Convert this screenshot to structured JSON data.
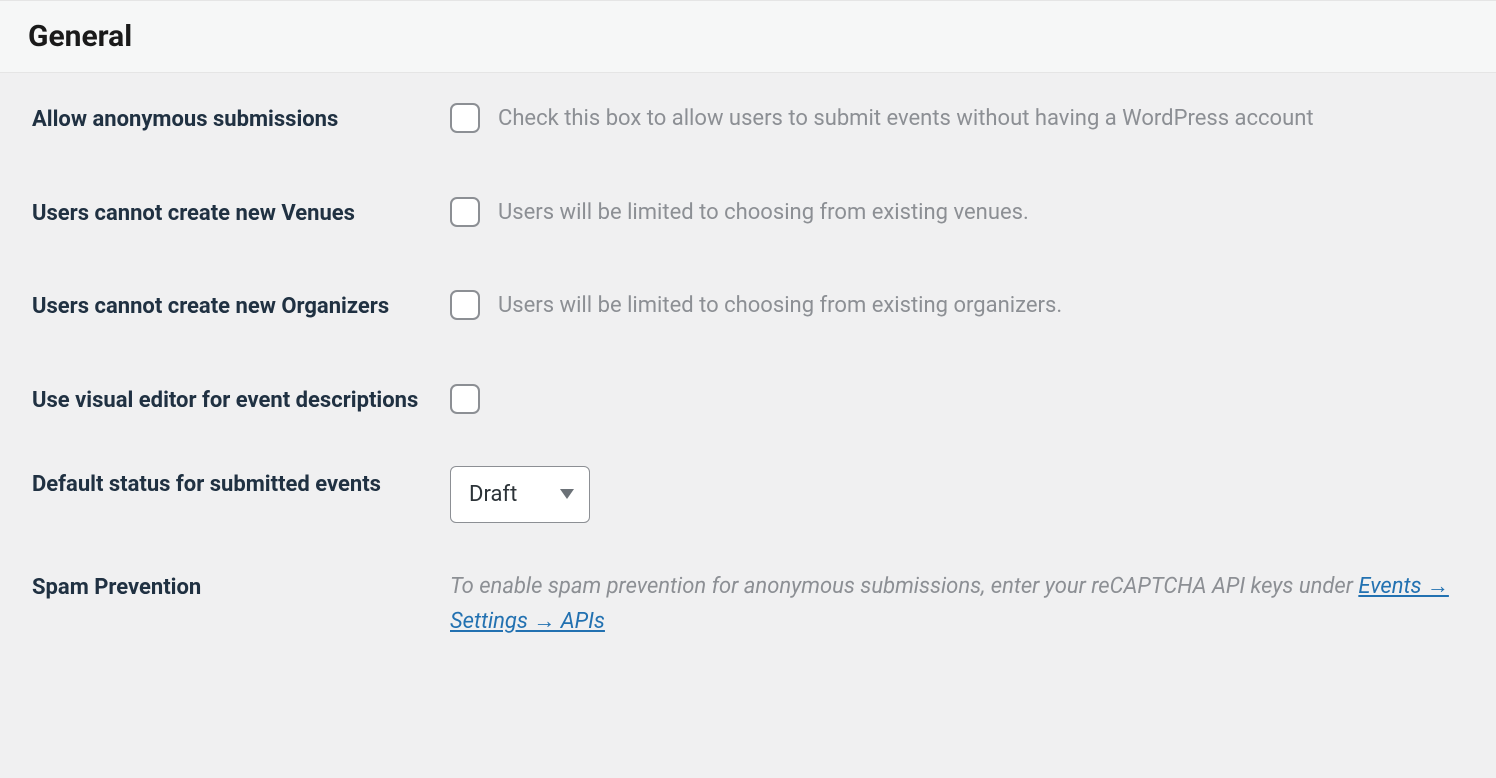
{
  "section": {
    "title": "General"
  },
  "settings": {
    "anon": {
      "label": "Allow anonymous submissions",
      "desc": "Check this box to allow users to submit events without having a WordPress account"
    },
    "venues": {
      "label": "Users cannot create new Venues",
      "desc": "Users will be limited to choosing from existing venues."
    },
    "organizers": {
      "label": "Users cannot create new Organizers",
      "desc": "Users will be limited to choosing from existing organizers."
    },
    "visual_editor": {
      "label": "Use visual editor for event descriptions"
    },
    "default_status": {
      "label": "Default status for submitted events",
      "selected": "Draft"
    },
    "spam": {
      "label": "Spam Prevention",
      "desc_prefix": "To enable spam prevention for anonymous submissions, enter your reCAPTCHA API keys under ",
      "link_text": "Events → Settings → APIs"
    }
  }
}
